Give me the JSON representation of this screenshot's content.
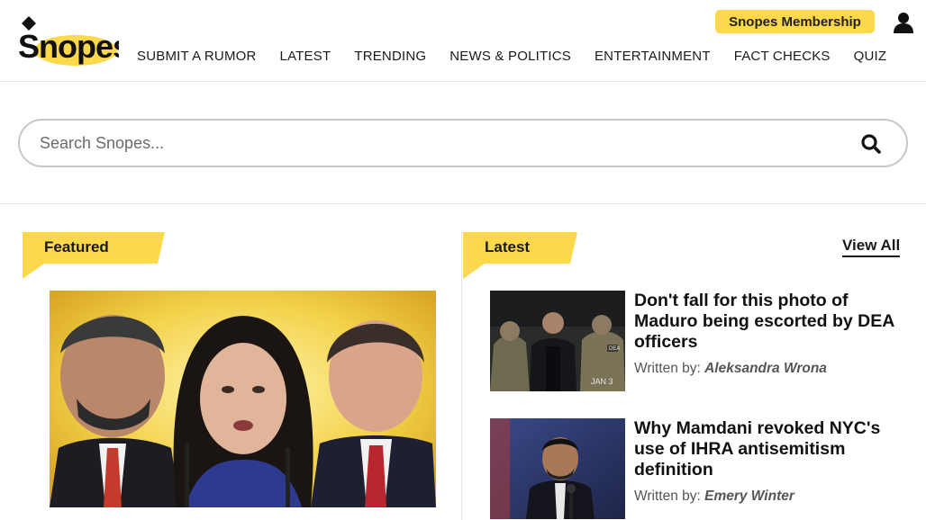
{
  "header": {
    "logo_text": "Snopes",
    "membership_label": "Snopes Membership",
    "nav": [
      "SUBMIT A RUMOR",
      "LATEST",
      "TRENDING",
      "NEWS & POLITICS",
      "ENTERTAINMENT",
      "FACT CHECKS",
      "QUIZ"
    ],
    "user_icon": "user-icon"
  },
  "search": {
    "placeholder": "Search Snopes...",
    "icon": "search-icon"
  },
  "featured": {
    "label": "Featured"
  },
  "latest": {
    "label": "Latest",
    "view_all": "View All",
    "articles": [
      {
        "title": "Don't fall for this photo of Maduro being escorted by DEA officers",
        "byline_prefix": "Written by:",
        "author": "Aleksandra Wrona",
        "thumb_caption": "JAN 3"
      },
      {
        "title": "Why Mamdani revoked NYC's use of IHRA antisemitism definition",
        "byline_prefix": "Written by:",
        "author": "Emery Winter"
      }
    ]
  },
  "colors": {
    "accent_yellow": "#fcd84a",
    "text": "#111111",
    "border": "#c8c8c8"
  }
}
